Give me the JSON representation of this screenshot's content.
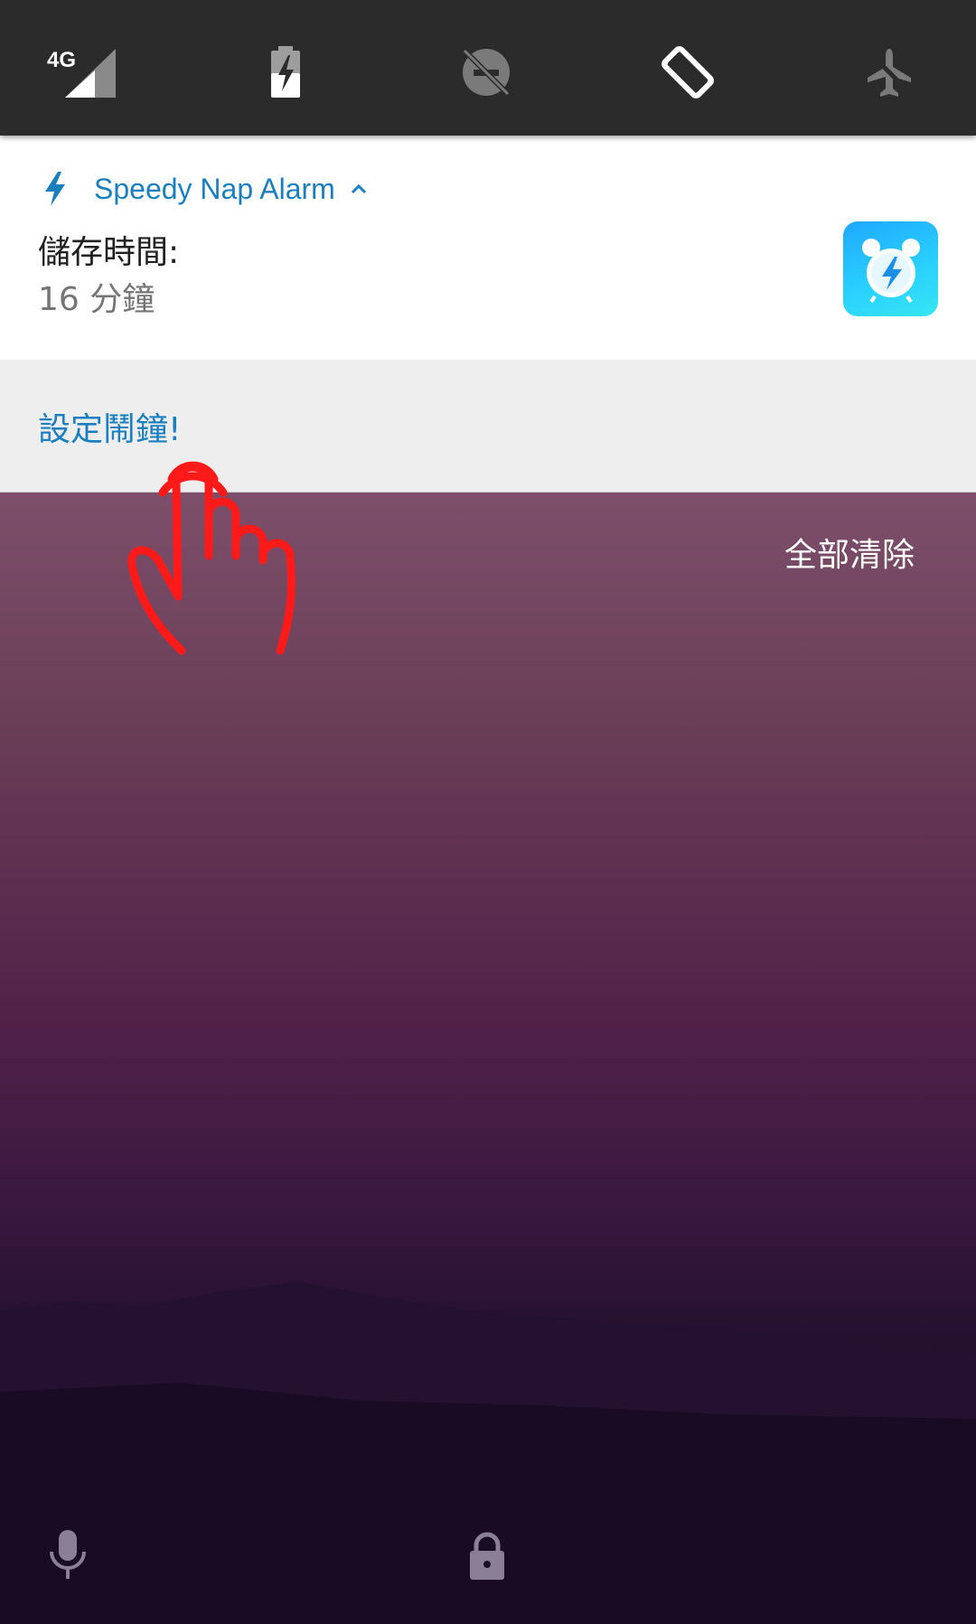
{
  "quick_settings": {
    "tiles": [
      {
        "name": "signal-4g",
        "label": "4G",
        "icon": "signal-icon"
      },
      {
        "name": "battery-saver",
        "icon": "battery-charging-icon"
      },
      {
        "name": "do-not-disturb",
        "icon": "dnd-off-icon"
      },
      {
        "name": "auto-rotate",
        "icon": "auto-rotate-icon"
      },
      {
        "name": "airplane-mode",
        "icon": "airplane-icon"
      }
    ]
  },
  "notification": {
    "app_name": "Speedy Nap Alarm",
    "title": "儲存時間:",
    "text": "16 分鐘",
    "large_icon": "alarm-clock-icon",
    "accent_color": "#1a7fbf",
    "action_label": "設定鬧鐘!"
  },
  "shade": {
    "clear_all_label": "全部清除"
  },
  "bottom_bar": {
    "left_icon": "mic-icon",
    "center_icon": "lock-icon"
  },
  "overlay": {
    "icon": "tap-gesture-hand-icon",
    "color": "#ff1a1a"
  }
}
